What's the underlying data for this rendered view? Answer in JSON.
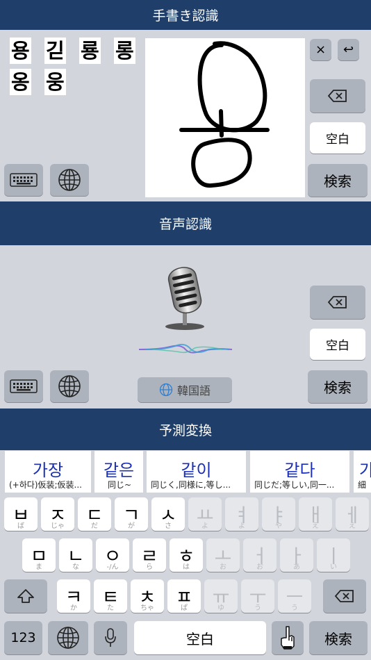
{
  "handwriting": {
    "title": "手書き認識",
    "candidates": [
      "용",
      "긷",
      "룡",
      "롱",
      "옹",
      "웅"
    ],
    "clear_label": "×",
    "undo_label": "↩",
    "space_label": "空白",
    "search_label": "検索"
  },
  "voice": {
    "title": "音声認識",
    "language_label": "韓国語",
    "space_label": "空白",
    "search_label": "検索"
  },
  "prediction": {
    "title": "予測変換",
    "items": [
      {
        "word": "가장",
        "meaning": "(+하다)仮装;仮装..."
      },
      {
        "word": "같은",
        "meaning": "同じ~"
      },
      {
        "word": "같이",
        "meaning": "同じく,同様に,等し..."
      },
      {
        "word": "같다",
        "meaning": "同じだ;等しい,同一..."
      },
      {
        "word": "가",
        "meaning": "細"
      }
    ]
  },
  "keyboard": {
    "row1": [
      {
        "g": "ㅂ",
        "r": "ば"
      },
      {
        "g": "ㅈ",
        "r": "じゃ"
      },
      {
        "g": "ㄷ",
        "r": "だ"
      },
      {
        "g": "ㄱ",
        "r": "が"
      },
      {
        "g": "ㅅ",
        "r": "さ"
      },
      {
        "g": "ㅛ",
        "r": "よ"
      },
      {
        "g": "ㅕ",
        "r": "よ"
      },
      {
        "g": "ㅑ",
        "r": "や"
      },
      {
        "g": "ㅐ",
        "r": "え"
      },
      {
        "g": "ㅔ",
        "r": "え"
      }
    ],
    "row2": [
      {
        "g": "ㅁ",
        "r": "ま"
      },
      {
        "g": "ㄴ",
        "r": "な"
      },
      {
        "g": "ㅇ",
        "r": "-/ん"
      },
      {
        "g": "ㄹ",
        "r": "ら"
      },
      {
        "g": "ㅎ",
        "r": "は"
      },
      {
        "g": "ㅗ",
        "r": "お"
      },
      {
        "g": "ㅓ",
        "r": "お"
      },
      {
        "g": "ㅏ",
        "r": "あ"
      },
      {
        "g": "ㅣ",
        "r": "い"
      }
    ],
    "row3": [
      {
        "g": "ㅋ",
        "r": "か"
      },
      {
        "g": "ㅌ",
        "r": "た"
      },
      {
        "g": "ㅊ",
        "r": "ちゃ"
      },
      {
        "g": "ㅍ",
        "r": "ぱ"
      },
      {
        "g": "ㅠ",
        "r": "ゆ"
      },
      {
        "g": "ㅜ",
        "r": "う"
      },
      {
        "g": "ㅡ",
        "r": "う"
      }
    ],
    "num_label": "123",
    "space_label": "空白",
    "search_label": "検索"
  }
}
